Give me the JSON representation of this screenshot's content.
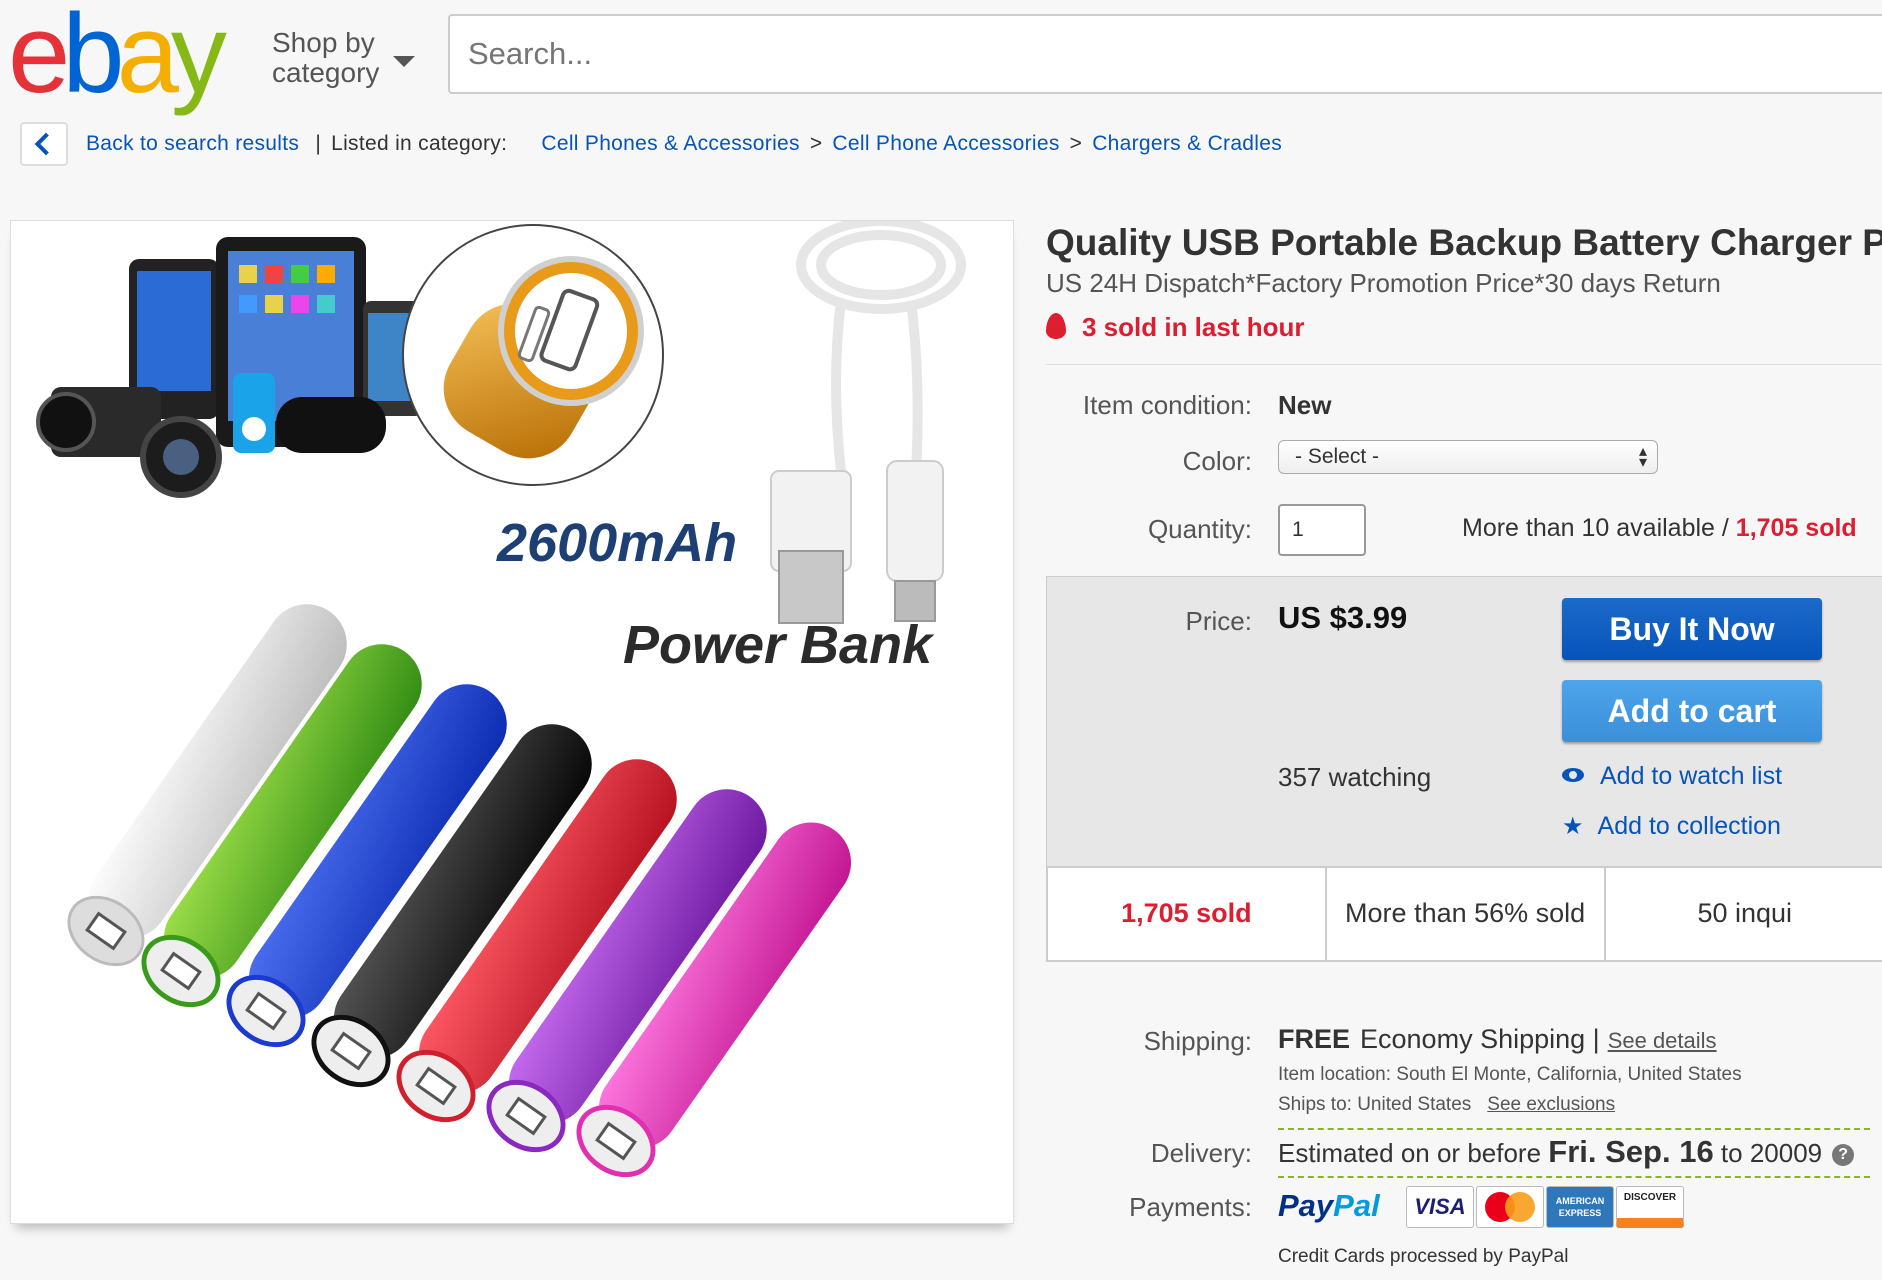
{
  "header": {
    "logo": {
      "e": "e",
      "b": "b",
      "a": "a",
      "y": "y"
    },
    "shop_by_line1": "Shop by",
    "shop_by_line2": "category",
    "search_placeholder": "Search..."
  },
  "breadcrumb": {
    "back_label": "Back to search results",
    "listed_label": "Listed in category:",
    "items": [
      "Cell Phones & Accessories",
      "Cell Phone Accessories",
      "Chargers & Cradles"
    ],
    "separator": ">"
  },
  "image": {
    "capacity_text": "2600mAh",
    "product_text": "Power Bank"
  },
  "item": {
    "title": "Quality USB Portable Backup Battery Charger Po",
    "subtitle": "US 24H Dispatch*Factory Promotion Price*30 days Return",
    "hot_text": "3 sold in last hour",
    "condition_label": "Item condition:",
    "condition_value": "New",
    "color_label": "Color:",
    "color_selected": "- Select -",
    "quantity_label": "Quantity:",
    "quantity_value": "1",
    "available_text": "More than 10 available /",
    "sold_text": "1,705 sold"
  },
  "price": {
    "label": "Price:",
    "value": "US $3.99",
    "buy_now": "Buy It Now",
    "add_to_cart": "Add to cart",
    "watching": "357 watching",
    "add_watch": "Add to watch list",
    "add_collection": "Add to collection"
  },
  "stats": [
    {
      "text": "1,705 sold"
    },
    {
      "text": "More than 56% sold"
    },
    {
      "text": "50 inqui"
    }
  ],
  "shipping": {
    "label": "Shipping:",
    "free": "FREE",
    "method": "Economy Shipping",
    "divider": "|",
    "see_details": "See details",
    "item_location": "Item location:  South El Monte, California, United States",
    "ships_to": "Ships to:  United States",
    "see_exclusions": "See exclusions"
  },
  "delivery": {
    "label": "Delivery:",
    "prefix": "Estimated on or before",
    "date": "Fri. Sep. 16",
    "suffix": "to 20009",
    "help": "?"
  },
  "payments": {
    "label": "Payments:",
    "paypal_1": "Pay",
    "paypal_2": "Pal",
    "visa": "VISA",
    "amex": "AMERICAN EXPRESS",
    "discover": "DISCOVER",
    "note": "Credit Cards processed by PayPal"
  },
  "colors": {
    "link": "#0654ba",
    "alert_red": "#dd1e31",
    "buy_blue": "#0654ba",
    "cart_blue": "#3a8fd9",
    "dash_green": "#86b817"
  }
}
